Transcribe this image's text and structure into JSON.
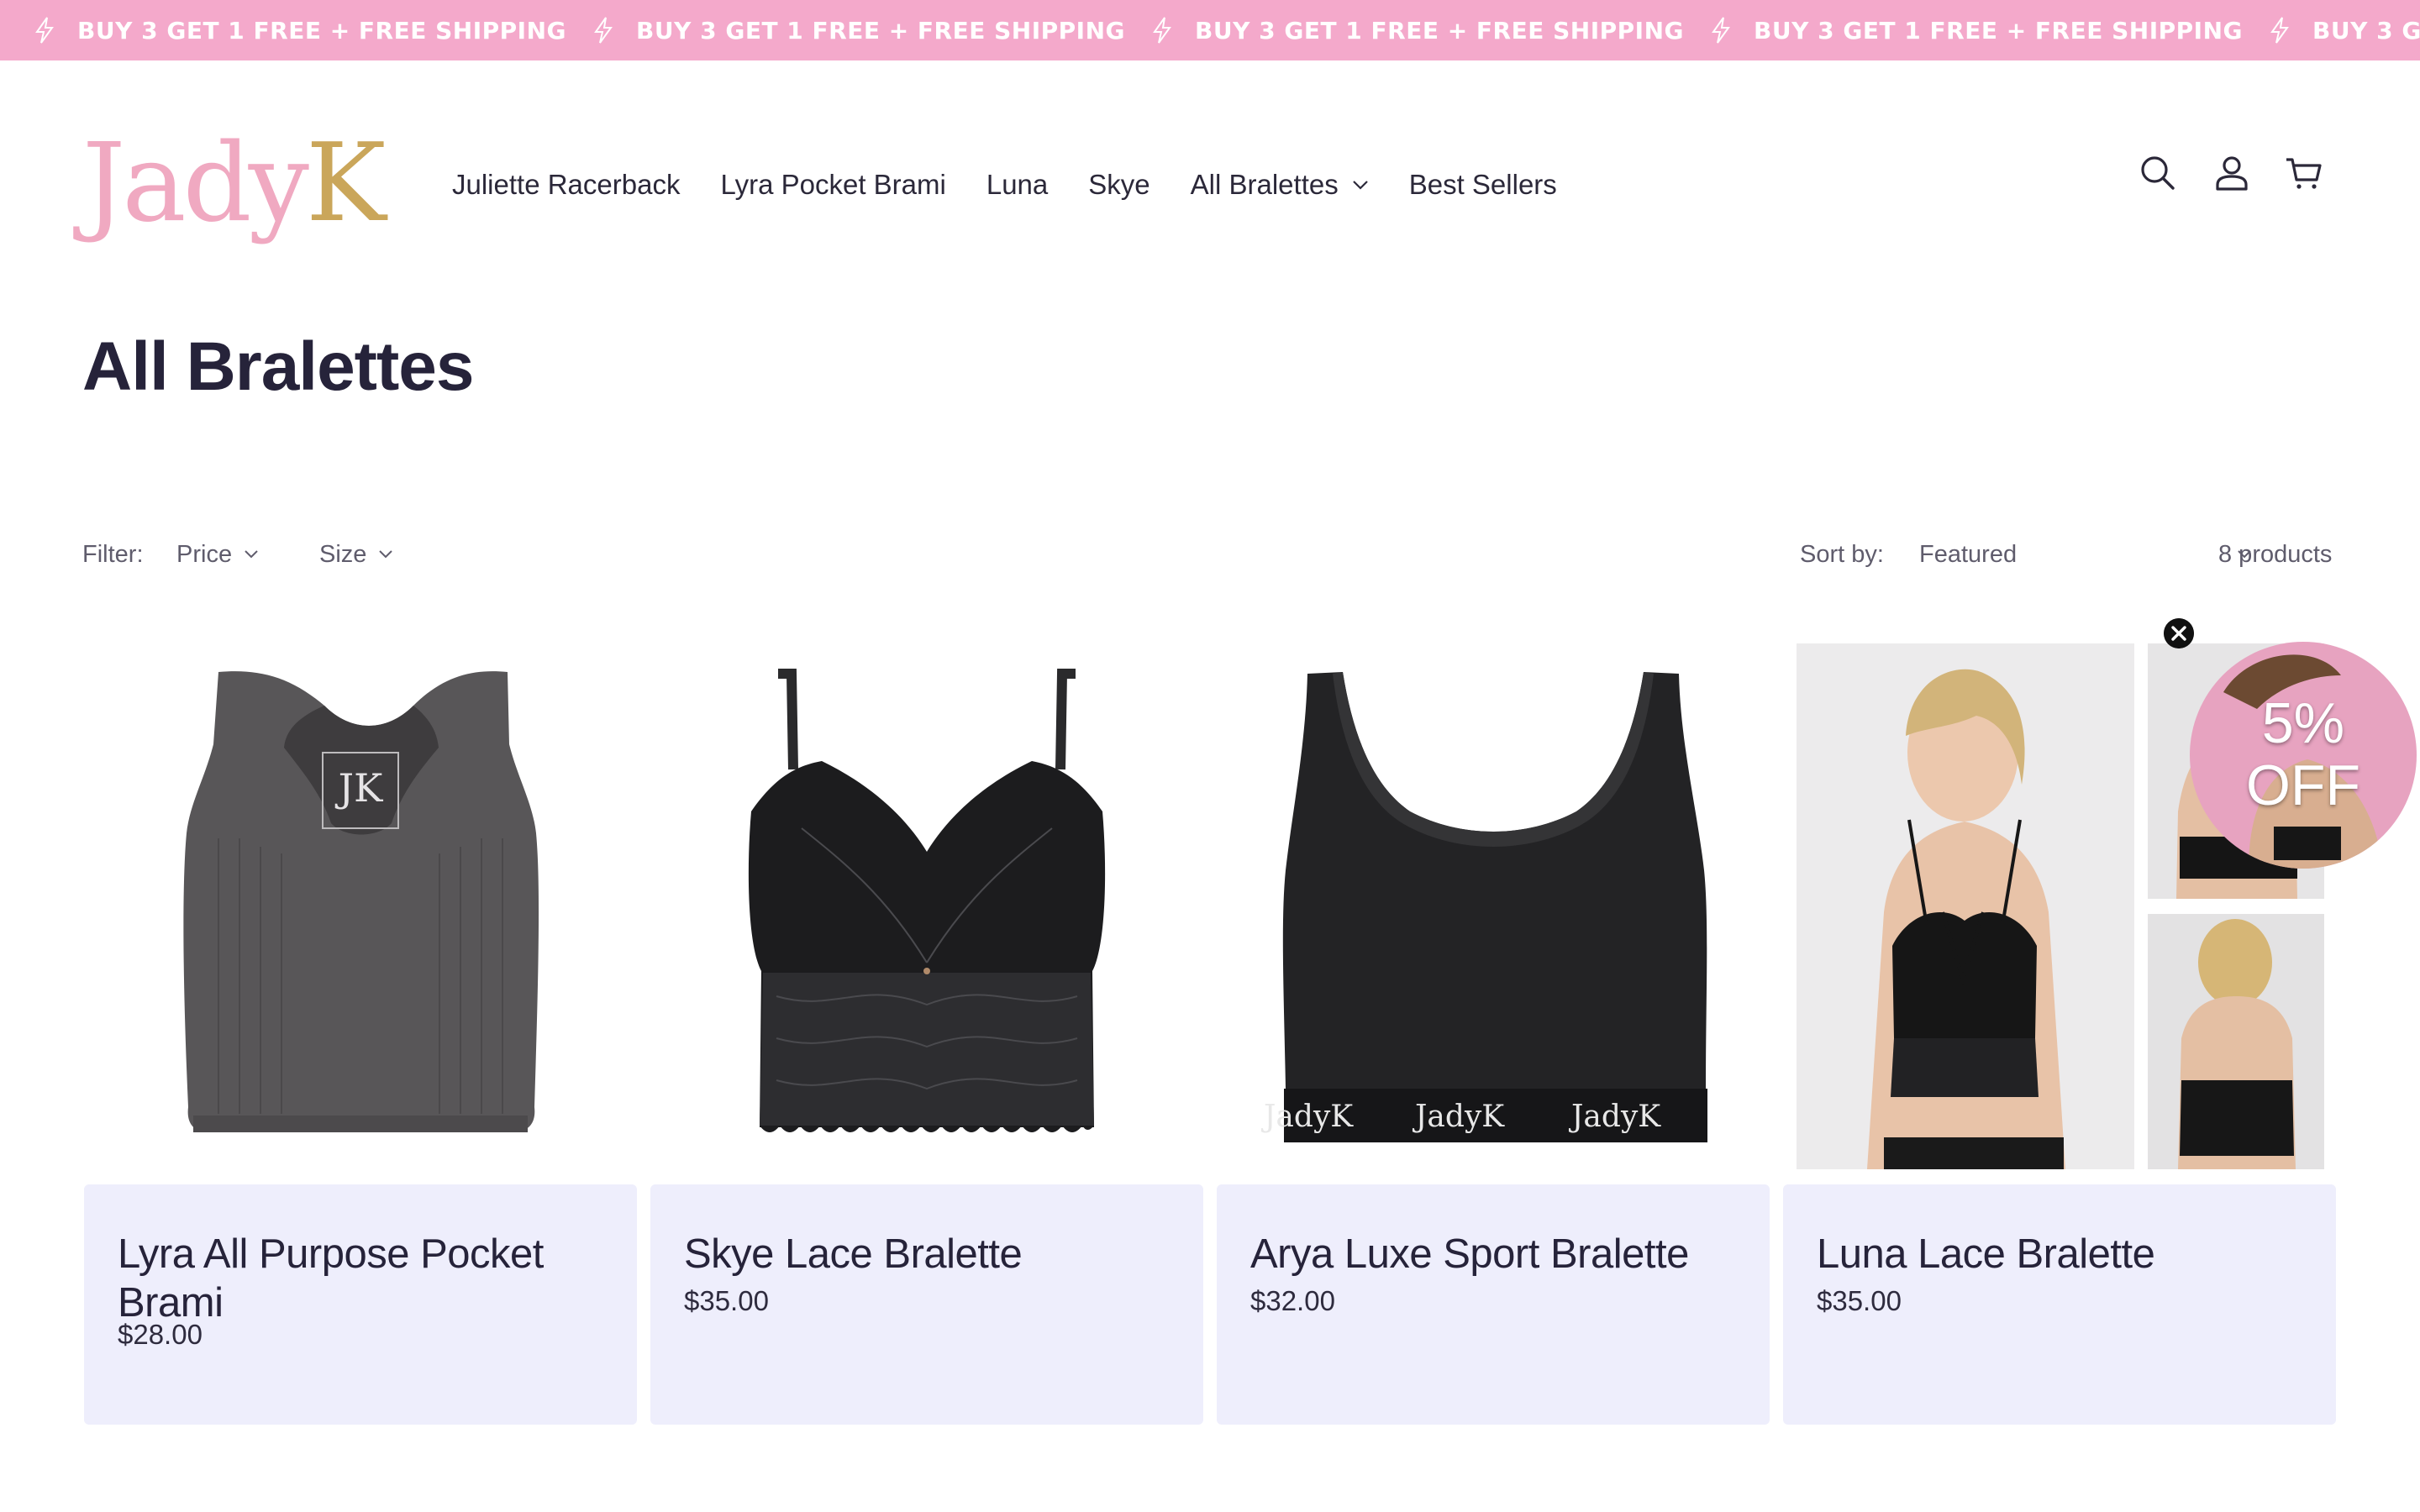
{
  "announcement": {
    "text": "BUY 3 GET 1 FREE + FREE SHIPPING",
    "repeats": 5,
    "background": "#f4a9cb",
    "icon": "lightning-icon"
  },
  "header": {
    "logo": {
      "part1": "Jady",
      "part2": "K"
    },
    "nav": [
      {
        "label": "Juliette Racerback"
      },
      {
        "label": "Lyra Pocket Brami"
      },
      {
        "label": "Luna"
      },
      {
        "label": "Skye"
      },
      {
        "label": "All Bralettes",
        "has_dropdown": true
      },
      {
        "label": "Best Sellers"
      }
    ],
    "icons": [
      "search-icon",
      "account-icon",
      "cart-icon"
    ]
  },
  "page": {
    "title": "All Bralettes"
  },
  "filters": {
    "filter_label": "Filter:",
    "price_label": "Price",
    "size_label": "Size",
    "sort_label": "Sort by:",
    "sort_value": "Featured",
    "product_count": "8 products"
  },
  "products": [
    {
      "title": "Lyra All Purpose Pocket Brami",
      "price": "$28.00",
      "image": "grey ribbed racerback crop top with JK label"
    },
    {
      "title": "Skye Lace Bralette",
      "price": "$35.00",
      "image": "black lace bralette with thin straps"
    },
    {
      "title": "Arya Luxe Sport Bralette",
      "price": "$32.00",
      "image": "black sport bralette with JadyK waistband"
    },
    {
      "title": "Luna Lace Bralette",
      "price": "$35.00",
      "image": "model wearing black lace strappy bralette"
    }
  ],
  "band_text": [
    "JadyK",
    "JadyK",
    "JadyK"
  ],
  "logo_label": "JK",
  "promo": {
    "line1": "5%",
    "line2": "OFF"
  },
  "colors": {
    "accent_pink": "#f4a9cb",
    "card_bg": "#eeeefc",
    "text_dark": "#26233a",
    "logo_gold": "#caa65a",
    "logo_pink": "#f0a9c1"
  }
}
